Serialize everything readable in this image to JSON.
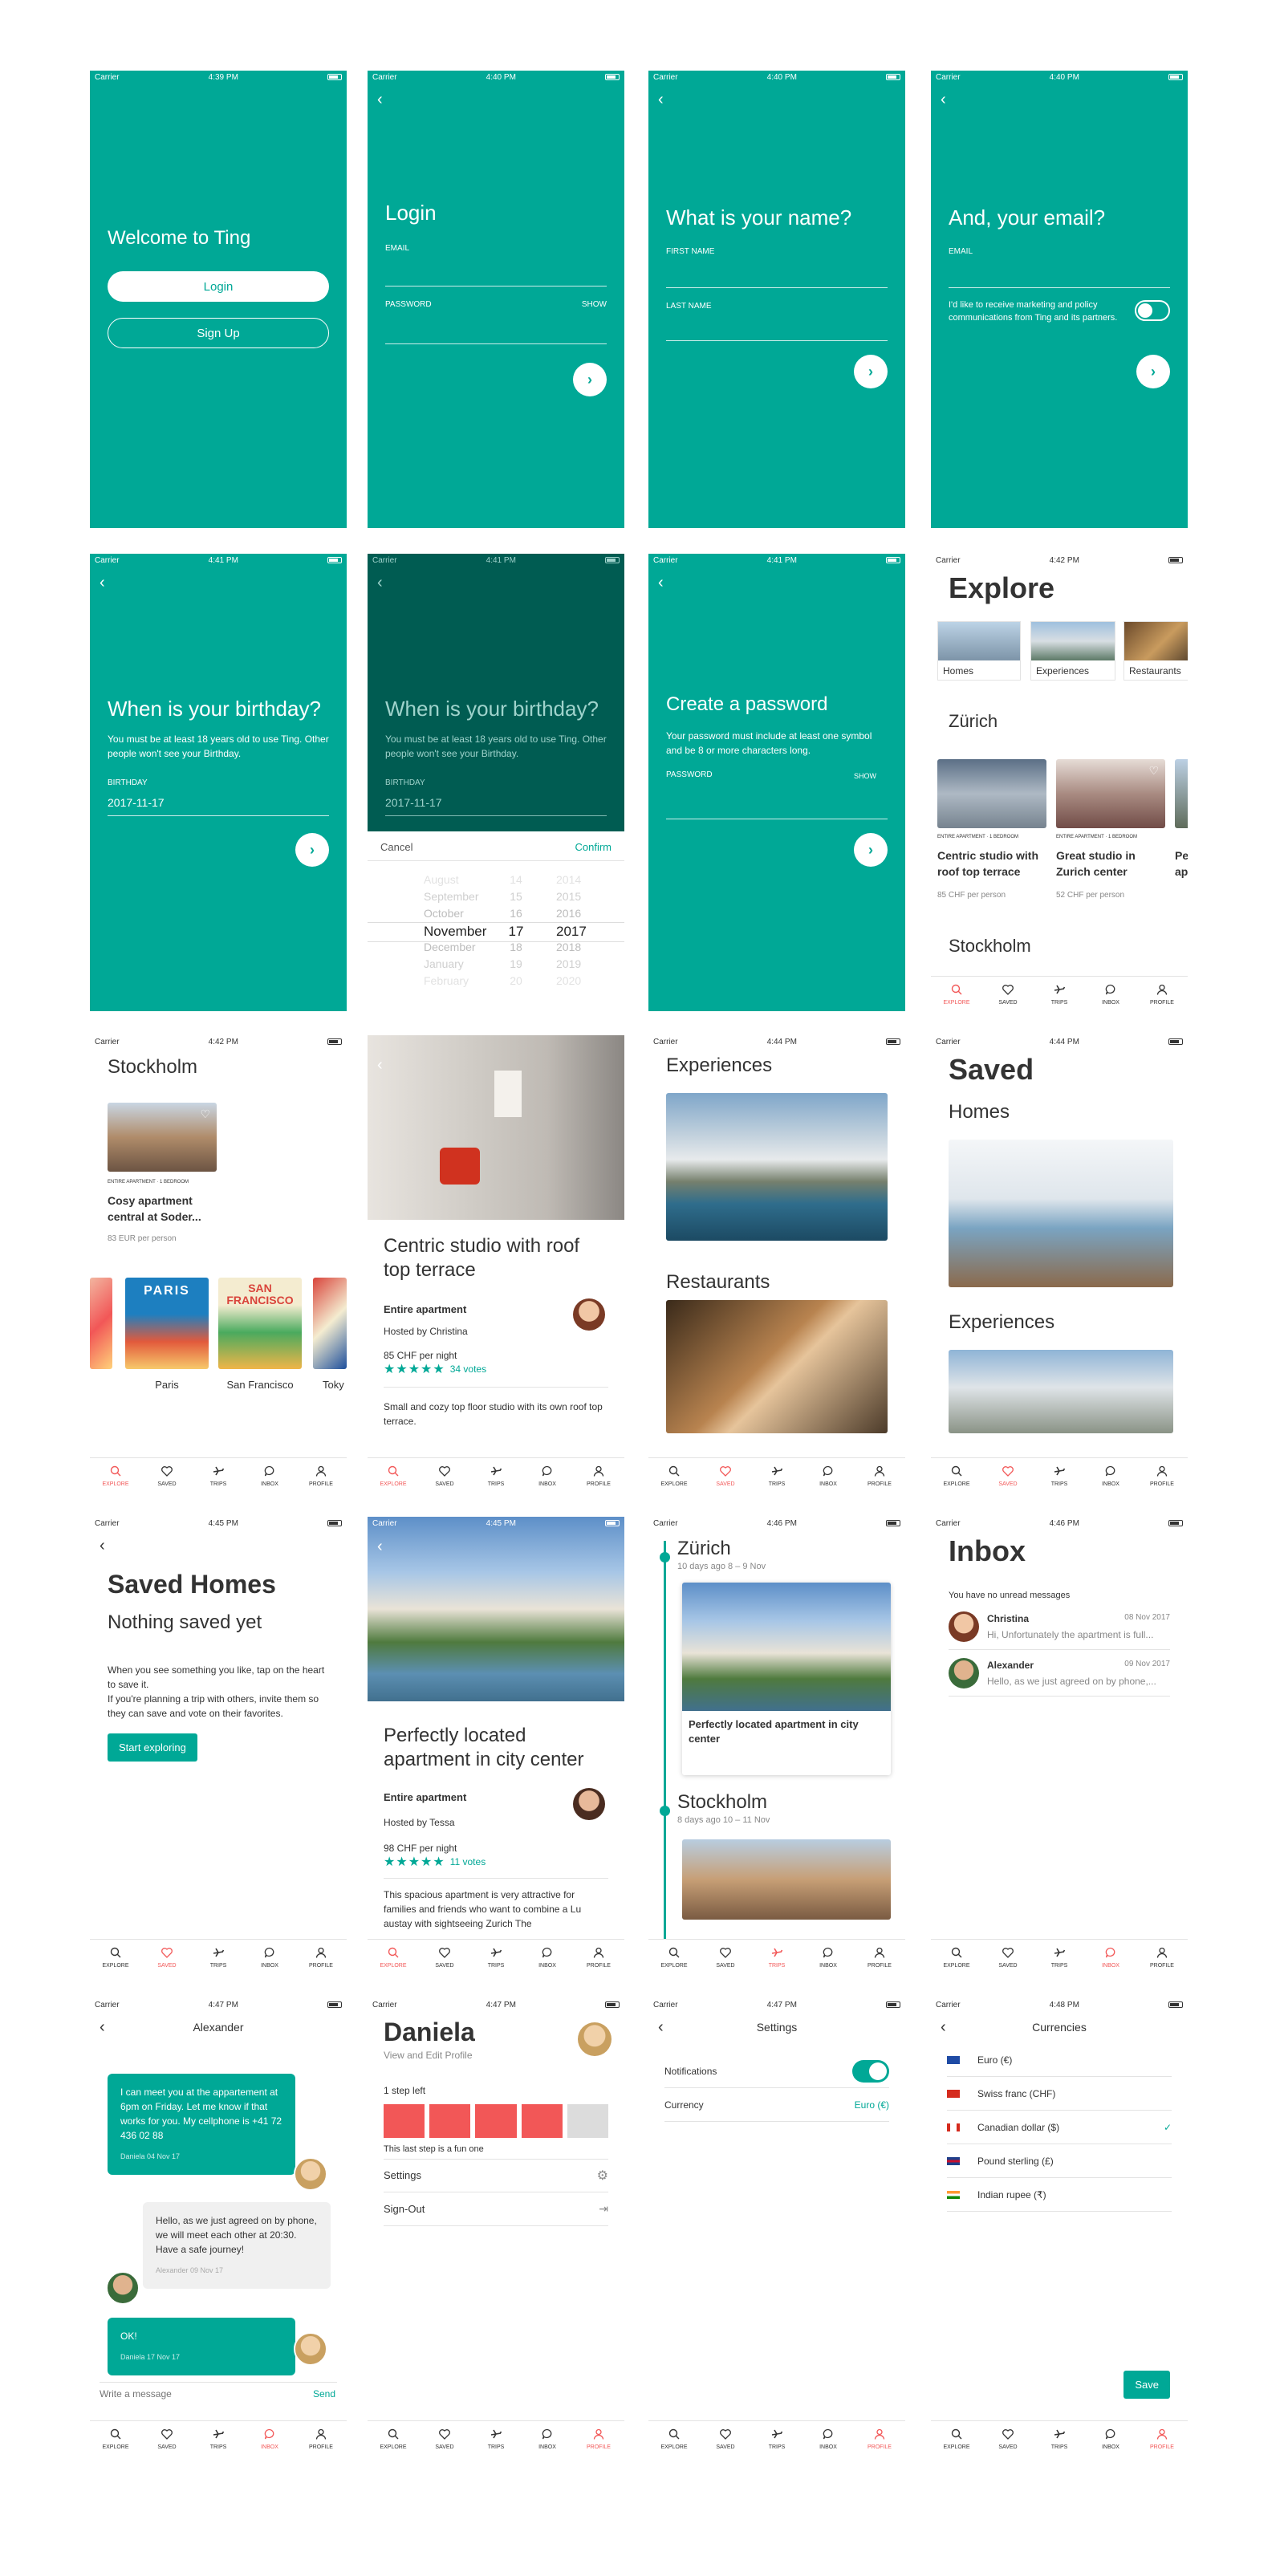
{
  "status": {
    "carrier": "Carrier",
    "t1": "4:39 PM",
    "t2": "4:40 PM",
    "t3": "4:41 PM",
    "t4": "4:42 PM",
    "t5": "4:44 PM",
    "t6": "4:45 PM",
    "t7": "4:46 PM",
    "t8": "4:47 PM",
    "t9": "4:48 PM"
  },
  "tabs": {
    "explore": "EXPLORE",
    "saved": "SAVED",
    "trips": "TRIPS",
    "inbox": "INBOX",
    "profile": "PROFILE"
  },
  "welcome": {
    "title": "Welcome to Ting",
    "login": "Login",
    "signup": "Sign Up"
  },
  "login": {
    "title": "Login",
    "email": "EMAIL",
    "password": "PASSWORD",
    "show": "SHOW"
  },
  "name": {
    "title": "What is your name?",
    "first": "FIRST NAME",
    "last": "LAST NAME"
  },
  "email": {
    "title": "And, your email?",
    "email": "EMAIL",
    "consent": "I'd like to receive marketing and policy communications from Ting and its partners."
  },
  "birthday": {
    "title": "When is your birthday?",
    "note": "You must be at least 18 years old to use Ting. Other people won't see your Birthday.",
    "label": "BIRTHDAY",
    "value": "2017-11-17"
  },
  "picker": {
    "cancel": "Cancel",
    "confirm": "Confirm",
    "months": [
      "August",
      "September",
      "October",
      "November",
      "December",
      "January",
      "February"
    ],
    "days": [
      "14",
      "15",
      "16",
      "17",
      "18",
      "19",
      "20"
    ],
    "years": [
      "2014",
      "2015",
      "2016",
      "2017",
      "2018",
      "2019",
      "2020"
    ]
  },
  "password": {
    "title": "Create a password",
    "note": "Your password must include at least one symbol and be 8 or more characters long.",
    "label": "PASSWORD",
    "show": "SHOW"
  },
  "explore": {
    "title": "Explore",
    "cats": [
      "Homes",
      "Experiences",
      "Restaurants"
    ],
    "city": "Zürich",
    "listings": [
      {
        "tag": "ENTIRE APARTMENT · 1 BEDROOM",
        "name": "Centric studio with roof top terrace",
        "price": "85 CHF per person"
      },
      {
        "tag": "ENTIRE APARTMENT · 1 BEDROOM",
        "name": "Great studio in Zurich center",
        "price": "52 CHF per person"
      },
      {
        "name": "Pe ap"
      }
    ],
    "city2": "Stockholm"
  },
  "stockholm": {
    "city": "Stockholm",
    "tag": "ENTIRE APARTMENT · 1 BEDROOM",
    "name": "Cosy apartment central at Soder...",
    "price": "83 EUR per person",
    "posters": [
      "Paris",
      "San Francisco",
      "Toky"
    ],
    "poster_text": [
      "PARIS",
      "SAN FRANCISCO"
    ]
  },
  "detail1": {
    "title": "Centric studio with roof top terrace",
    "type": "Entire apartment",
    "host": "Hosted by Christina",
    "price": "85 CHF per night",
    "stars": "★★★★★",
    "votes": "34 votes",
    "desc": "Small and cozy top floor studio with its own roof top terrace."
  },
  "experiences": {
    "title": "Experiences",
    "restaurants": "Restaurants"
  },
  "saved": {
    "title": "Saved",
    "homes": "Homes",
    "experiences": "Experiences"
  },
  "savedHomes": {
    "title": "Saved Homes",
    "empty": "Nothing saved yet",
    "text": "When you see something you like, tap on the heart to save it.\nIf you're planning a trip with others, invite them so they can save and vote on their favorites.",
    "cta": "Start exploring"
  },
  "detail2": {
    "title": "Perfectly located apartment in city center",
    "type": "Entire apartment",
    "host": "Hosted by Tessa",
    "price": "98 CHF per night",
    "stars": "★★★★★",
    "votes": "11 votes",
    "desc": "This spacious apartment is very attractive for families and friends who want to combine a Lu austay with sightseeing Zurich The"
  },
  "trips": {
    "city1": "Zürich",
    "dates1": "10 days ago 8 – 9 Nov",
    "card1": "Perfectly located apartment in city center",
    "city2": "Stockholm",
    "dates2": "8 days ago 10 – 11 Nov"
  },
  "inbox": {
    "title": "Inbox",
    "note": "You have no unread messages",
    "msgs": [
      {
        "name": "Christina",
        "date": "08 Nov 2017",
        "text": "Hi, Unfortunately the apartment is full..."
      },
      {
        "name": "Alexander",
        "date": "09 Nov 2017",
        "text": "Hello, as we just agreed on by phone,..."
      }
    ]
  },
  "chat": {
    "title": "Alexander",
    "m1": "I can meet you at the appartement at 6pm on Friday. Let me know if that works for you. My cellphone is +41 72 436 02 88",
    "m1meta": "Daniela 04 Nov 17",
    "m2": "Hello, as we just agreed on by phone, we will meet each other at 20:30. Have a safe journey!",
    "m2meta": "Alexander 09 Nov 17",
    "m3": "OK!",
    "m3meta": "Daniela 17 Nov 17",
    "placeholder": "Write a message",
    "send": "Send"
  },
  "profile": {
    "name": "Daniela",
    "sub": "View and Edit Profile",
    "steps": "1 step left",
    "stepnote": "This last step is a fun one",
    "settings": "Settings",
    "signout": "Sign-Out",
    "progress": 0.8
  },
  "settings": {
    "title": "Settings",
    "notifications": "Notifications",
    "currency": "Currency",
    "currency_val": "Euro (€)"
  },
  "currencies": {
    "title": "Currencies",
    "items": [
      "Euro (€)",
      "Swiss franc (CHF)",
      "Canadian dollar ($)",
      "Pound sterling (£)",
      "Indian rupee (₹)"
    ],
    "check": "✓",
    "save": "Save"
  },
  "colors": {
    "teal": "#00a896",
    "red": "#f25757",
    "dark": "#005c52"
  }
}
